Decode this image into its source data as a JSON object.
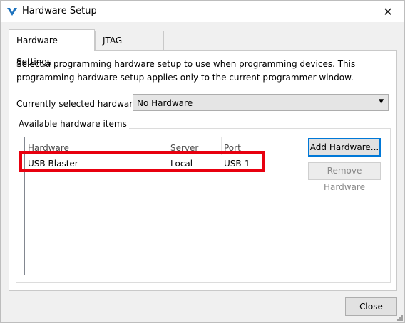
{
  "window": {
    "title": "Hardware Setup"
  },
  "tabs": [
    {
      "label": "Hardware Settings",
      "active": true
    },
    {
      "label": "JTAG Settings",
      "active": false
    }
  ],
  "settings": {
    "description": "Select a programming hardware setup to use when programming devices. This programming hardware setup applies only to the current programmer window.",
    "current_label": "Currently selected hardware:",
    "current_value": "No Hardware"
  },
  "available": {
    "group_title": "Available hardware items",
    "columns": [
      "Hardware",
      "Server",
      "Port"
    ],
    "rows": [
      {
        "hardware": "USB-Blaster",
        "server": "Local",
        "port": "USB-1"
      }
    ]
  },
  "buttons": {
    "add": "Add Hardware...",
    "remove": "Remove Hardware",
    "close": "Close"
  },
  "colors": {
    "highlight": "#e8000f",
    "focus": "#0078d7",
    "icon": "#1e73be"
  },
  "icons": {
    "app": "quartus-logo-icon",
    "close": "close-icon",
    "dropdown": "chevron-down-icon",
    "grip": "resize-grip-icon"
  }
}
